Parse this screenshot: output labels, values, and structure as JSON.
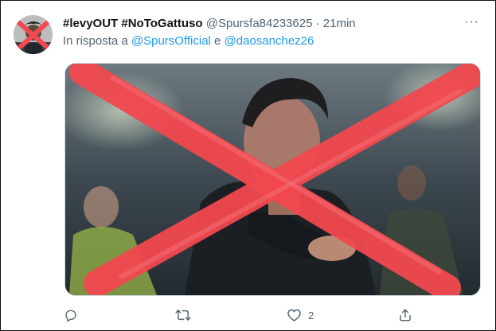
{
  "tweet": {
    "display_name": "#levyOUT #NoToGattuso",
    "handle": "@Spursfa84233625",
    "separator": "·",
    "time": "21min",
    "reply_prefix": "In risposta a",
    "reply_mention_1": "@SpursOfficial",
    "reply_conjunction": "e",
    "reply_mention_2": "@daosanchez26",
    "more_label": "···"
  },
  "actions": {
    "reply_count": "",
    "retweet_count": "",
    "like_count": "2",
    "share_count": ""
  },
  "colors": {
    "accent": "#1d9bf0",
    "secondary_text": "#536471",
    "cross_red": "#f2484f"
  }
}
